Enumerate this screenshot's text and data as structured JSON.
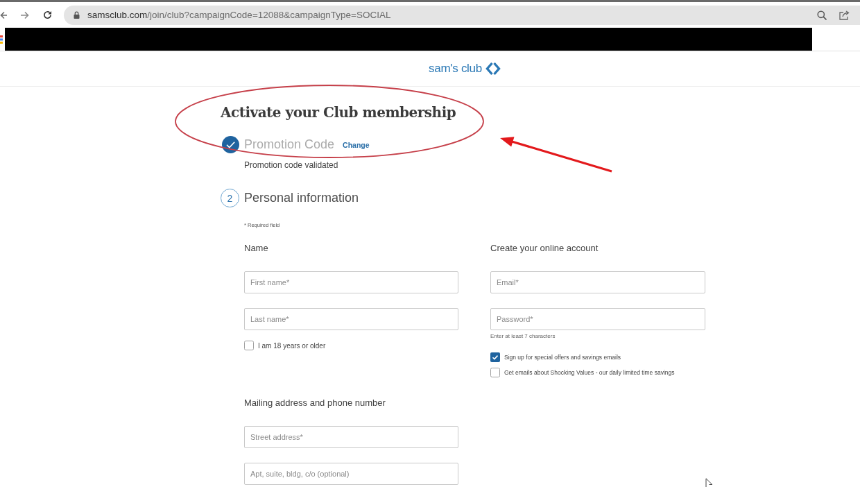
{
  "browser": {
    "url_host": "samsclub.com",
    "url_path": "/join/club?campaignCode=12088&campaignType=SOCIAL"
  },
  "header": {
    "logo": "sam's club"
  },
  "page_title": "Activate your Club membership",
  "steps": [
    {
      "kind": "done",
      "title": "Promotion Code",
      "action": "Change",
      "status": "Promotion code validated"
    },
    {
      "kind": "current",
      "number": "2",
      "title": "Personal information"
    }
  ],
  "form": {
    "required_note": "* Required field",
    "rows": [
      [
        {
          "heading": "Name",
          "items": [
            {
              "kind": "field",
              "placeholder": "First name*"
            },
            {
              "kind": "field",
              "placeholder": "Last name*"
            },
            {
              "kind": "checkbox",
              "label": "I am 18 years or older",
              "checked": false
            }
          ]
        },
        {
          "heading": "Create your online account",
          "items": [
            {
              "kind": "field",
              "placeholder": "Email*"
            },
            {
              "kind": "field",
              "placeholder": "Password*",
              "hint": "Enter at least 7 characters"
            },
            {
              "kind": "checkbox",
              "label": "Sign up for special offers and savings emails",
              "checked": true
            },
            {
              "kind": "checkbox",
              "label": "Get emails about Shocking Values - our daily limited time savings",
              "checked": false
            }
          ]
        }
      ],
      [
        {
          "heading": "Mailing address and phone number",
          "items": [
            {
              "kind": "field",
              "placeholder": "Street address*"
            },
            {
              "kind": "field",
              "placeholder": "Apt, suite, bldg, c/o (optional)"
            }
          ]
        }
      ]
    ]
  }
}
